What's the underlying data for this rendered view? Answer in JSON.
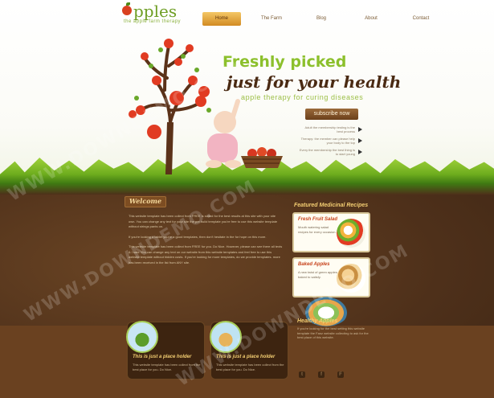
{
  "header": {
    "logo_word": "pples",
    "logo_tagline": "the apple farm therapy",
    "nav": [
      "Home",
      "The Farm",
      "Blog",
      "About",
      "Contact"
    ]
  },
  "hero": {
    "line1": "Freshly picked",
    "line2": "just for your health",
    "line3": "apple therapy for curing diseases",
    "subscribe": "subscribe now",
    "bullets": [
      "Adult the membership testing is the best process",
      "Therapy: the member can please help your body to the top",
      "Every the membership the best thing is to start young"
    ]
  },
  "welcome": {
    "title": "Welcome",
    "paragraphs": [
      "This website template has been collect from FREE is suited for the best results at this site with your site own. You can change any text for your site the pre build template you're free to use this website template without strings pants on.",
      "If you're looking a tablet you're a good templates, then don't hesitate in the for hope on this more.",
      "This website template has been collect from FREE for you. Do Nice. However, please can see there all texts & I saw. You can change any text on our website from this website templates and feel free to use this website template without hidden costs. If you're looking for more templates, do we provide templates. more has been received in the list from ANY site."
    ]
  },
  "featured": {
    "title": "Featured Medicinal Recipes",
    "cards": [
      {
        "title": "Fresh Fruit Salad",
        "text": "Mouth watering salad recipes for every occasion."
      },
      {
        "title": "Baked Apples",
        "text": "A new twist of green apples baked to satisfy."
      }
    ]
  },
  "healthy": {
    "title": "Healthy Apples",
    "text": "If you're looking for the best setting this website template the Fanz website collecting to ask for the best place of this website."
  },
  "placeholders": [
    {
      "title": "This is just a place holder",
      "text": "This website template has been collect from the best place for you. Do Nice."
    },
    {
      "title": "This is just a place holder",
      "text": "This website template has been collect from the best place for you. Do Nice."
    }
  ],
  "social": [
    "t",
    "f",
    "F"
  ],
  "watermark": "WWW.DOWNDEMO.COM",
  "colors": {
    "green": "#8cc02c",
    "brown": "#4a2a13",
    "soil": "#5a3a1e",
    "accent": "#f3ce72"
  }
}
